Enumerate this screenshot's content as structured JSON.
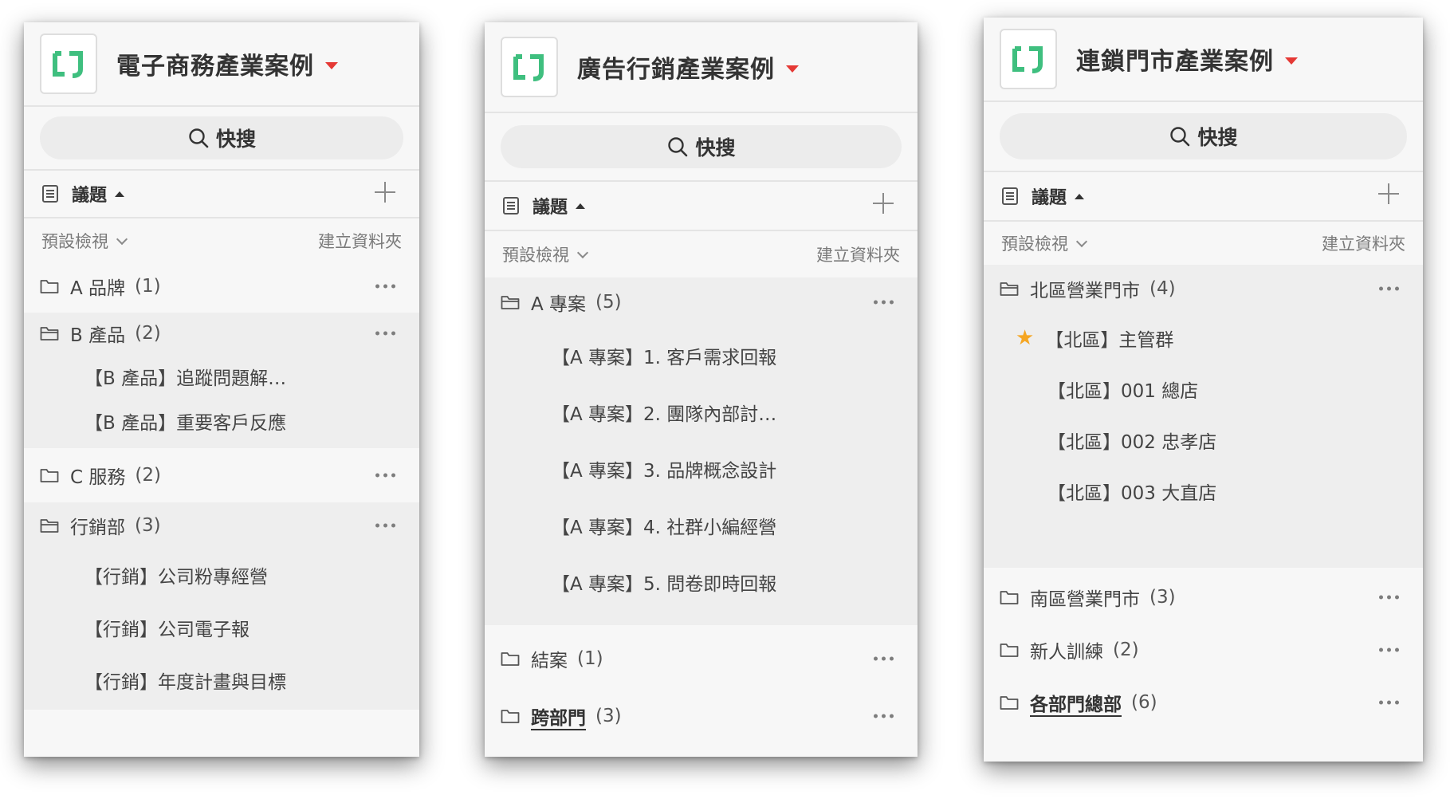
{
  "common": {
    "search_label": "快搜",
    "topics_label": "議題",
    "default_view": "預設檢視",
    "create_folder": "建立資料夾",
    "colors": {
      "logo_green": "#3fbf7f",
      "caret_red": "#e53935",
      "star": "#f5a623"
    }
  },
  "panels": [
    {
      "title": "電子商務產業案例",
      "folders": [
        {
          "name": "A 品牌",
          "count": "(1)",
          "items": []
        },
        {
          "name": "B 產品",
          "count": "(2)",
          "items": [
            "【B 產品】追蹤問題解…",
            "【B 產品】重要客戶反應"
          ]
        },
        {
          "name": "C 服務",
          "count": "(2)",
          "items": []
        },
        {
          "name": "行銷部",
          "count": "(3)",
          "items": [
            "【行銷】公司粉專經營",
            "【行銷】公司電子報",
            "【行銷】年度計畫與目標"
          ]
        }
      ]
    },
    {
      "title": "廣告行銷產業案例",
      "folders": [
        {
          "name": "A 專案",
          "count": "(5)",
          "items": [
            "【A 專案】1. 客戶需求回報",
            "【A 專案】2. 團隊內部討…",
            "【A 專案】3. 品牌概念設計",
            "【A 專案】4. 社群小編經營",
            "【A 專案】5. 問卷即時回報"
          ]
        },
        {
          "name": "結案",
          "count": "(1)",
          "items": []
        },
        {
          "name": "跨部門",
          "count": "(3)",
          "items": []
        }
      ]
    },
    {
      "title": "連鎖門市產業案例",
      "folders": [
        {
          "name": "北區營業門市",
          "count": "(4)",
          "items": [
            "【北區】主管群",
            "【北區】001 總店",
            "【北區】002 忠孝店",
            "【北區】003 大直店"
          ]
        },
        {
          "name": "南區營業門市",
          "count": "(3)",
          "items": []
        },
        {
          "name": "新人訓練",
          "count": "(2)",
          "items": []
        },
        {
          "name": "各部門總部",
          "count": "(6)",
          "items": []
        }
      ]
    }
  ]
}
